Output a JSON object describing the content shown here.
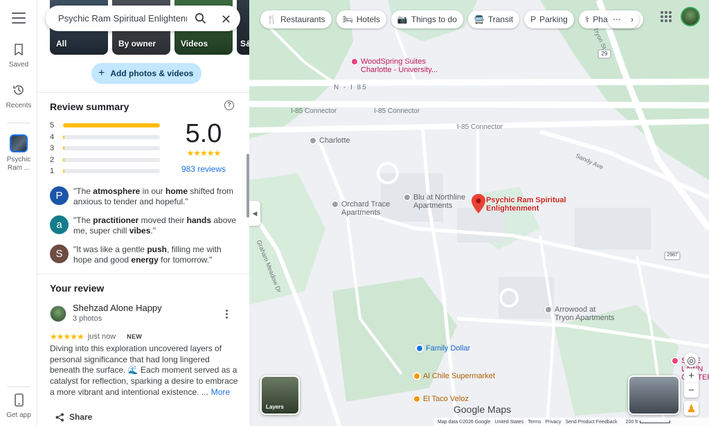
{
  "rail": {
    "saved": "Saved",
    "recents": "Recents",
    "place_label": "Psychic Ram ...",
    "get_app": "Get app"
  },
  "search": {
    "value": "Psychic Ram Spiritual Enlightenment"
  },
  "photos": {
    "tabs": [
      {
        "label": "All"
      },
      {
        "label": "By owner"
      },
      {
        "label": "Videos"
      },
      {
        "label": "S&"
      }
    ],
    "add_label": "Add photos & videos"
  },
  "review_summary": {
    "title": "Review summary",
    "rating": "5.0",
    "reviews_count": "983 reviews",
    "distribution": [
      {
        "stars": "5",
        "fraction": 1.0
      },
      {
        "stars": "4",
        "fraction": 0.01
      },
      {
        "stars": "3",
        "fraction": 0.01
      },
      {
        "stars": "2",
        "fraction": 0.01
      },
      {
        "stars": "1",
        "fraction": 0.01
      }
    ]
  },
  "quotes": [
    {
      "initial": "P",
      "color": "#1a56a8",
      "parts": [
        "\"The ",
        "atmosphere",
        " in our ",
        "home",
        " shifted from anxious to tender and hopeful.\""
      ]
    },
    {
      "initial": "a",
      "color": "#137d8c",
      "parts": [
        "\"The ",
        "practitioner",
        " moved their ",
        "hands",
        " above me, super chill ",
        "vibes",
        ".\""
      ]
    },
    {
      "initial": "S",
      "color": "#6d4c41",
      "parts": [
        "\"It was like a gentle ",
        "push",
        ", filling me with hope and good ",
        "energy",
        " for tomorrow.\""
      ]
    }
  ],
  "your_review": {
    "title": "Your review",
    "name": "Shehzad Alone Happy",
    "photos": "3 photos",
    "time": "just now",
    "badge": "NEW",
    "body": "Diving into this exploration uncovered layers of personal significance that had long lingered beneath the surface. 🌊 Each moment served as a catalyst for reflection, sparking a desire to embrace a more vibrant and intentional existence. ...",
    "more": "More",
    "share": "Share"
  },
  "chips": [
    {
      "icon": "🍴",
      "label": "Restaurants"
    },
    {
      "icon": "🛏",
      "label": "Hotels"
    },
    {
      "icon": "📷",
      "label": "Things to do"
    },
    {
      "icon": "🚍",
      "label": "Transit"
    },
    {
      "icon": "P",
      "label": "Parking"
    },
    {
      "icon": "⚕",
      "label": "Pharmacies"
    }
  ],
  "map": {
    "pin_label_1": "Psychic Ram Spiritual",
    "pin_label_2": "Enlightenment",
    "woodspring_1": "WoodSpring Suites",
    "woodspring_2": "Charlotte - University...",
    "charlotte": "Charlotte",
    "orchard_1": "Orchard Trace",
    "orchard_2": "Apartments",
    "blu_1": "Blu at Northline",
    "blu_2": "Apartments",
    "family_dollar": "Family Dollar",
    "chile": "Al Chile Supermarket",
    "taco": "El Taco Veloz",
    "lawn_1": "SALE",
    "lawn_2": "LAWN CENTER",
    "arrowood_1": "Arrowood at",
    "arrowood_2": "Tryon Apartments",
    "i85_1": "I-85 Connector",
    "i85_2": "I-85 Connector",
    "i85_3": "I-85 Connector",
    "n_i85": "N - I 85",
    "tryon": "N Tryon St",
    "sandy": "Sandy Ave",
    "meadow": "Graham Meadow Dr",
    "road_29": "29",
    "road_2987": "2987",
    "layers": "Layers",
    "logo": "Google Maps",
    "footer": {
      "data": "Map data ©2026 Google",
      "country": "United States",
      "terms": "Terms",
      "privacy": "Privacy",
      "feedback": "Send Product Feedback",
      "scale": "200 ft"
    }
  }
}
